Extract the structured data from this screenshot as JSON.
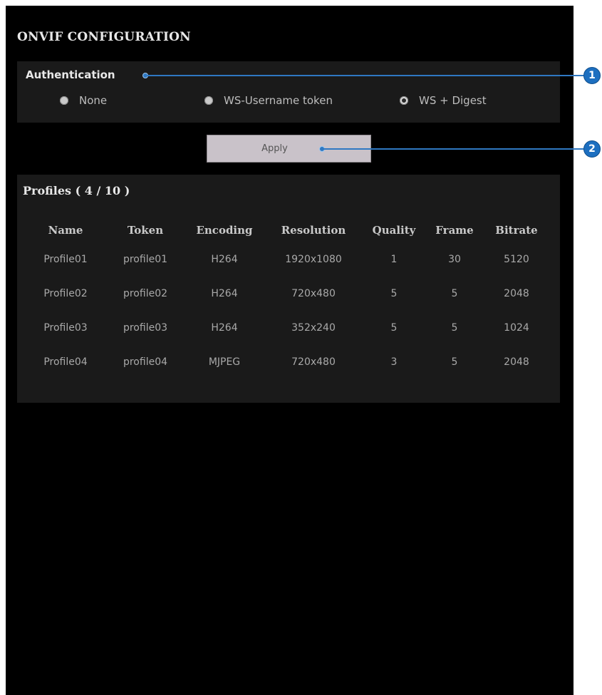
{
  "page": {
    "title": "ONVIF CONFIGURATION"
  },
  "authentication": {
    "title": "Authentication",
    "options": [
      {
        "label": "None",
        "checked": false
      },
      {
        "label": "WS-Username token",
        "checked": false
      },
      {
        "label": "WS + Digest",
        "checked": true
      }
    ]
  },
  "apply_label": "Apply",
  "profiles": {
    "title": "Profiles ( 4 / 10 )",
    "columns": [
      "Name",
      "Token",
      "Encoding",
      "Resolution",
      "Quality",
      "Frame",
      "Bitrate"
    ],
    "rows": [
      [
        "Profile01",
        "profile01",
        "H264",
        "1920x1080",
        "1",
        "30",
        "5120"
      ],
      [
        "Profile02",
        "profile02",
        "H264",
        "720x480",
        "5",
        "5",
        "2048"
      ],
      [
        "Profile03",
        "profile03",
        "H264",
        "352x240",
        "5",
        "5",
        "1024"
      ],
      [
        "Profile04",
        "profile04",
        "MJPEG",
        "720x480",
        "3",
        "5",
        "2048"
      ]
    ]
  },
  "callouts": [
    {
      "number": "1"
    },
    {
      "number": "2"
    }
  ],
  "colors": {
    "callout": "#2f78c2",
    "panel": "#000000",
    "section": "#1a1a1a"
  }
}
